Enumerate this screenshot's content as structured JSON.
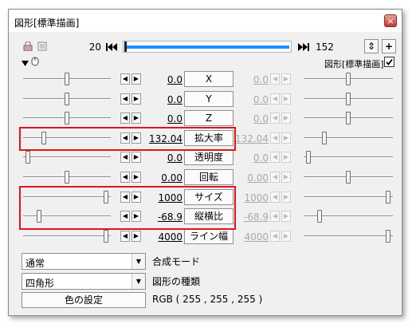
{
  "title": "図形[標準描画]",
  "close_glyph": "×",
  "timeline": {
    "start": "20",
    "end": "152"
  },
  "toolbar": {
    "refresh_glyph": "⇕",
    "add_glyph": "+"
  },
  "effect_header": {
    "label": "図形[標準描画]",
    "checked": true
  },
  "rows": [
    {
      "name": "x",
      "label": "X",
      "left_value": "0.0",
      "right_value": "0.0",
      "right_enabled": false,
      "left_level": 0.5,
      "right_level": 0.5
    },
    {
      "name": "y",
      "label": "Y",
      "left_value": "0.0",
      "right_value": "0.0",
      "right_enabled": false,
      "left_level": 0.5,
      "right_level": 0.5
    },
    {
      "name": "z",
      "label": "Z",
      "left_value": "0.0",
      "right_value": "0.0",
      "right_enabled": false,
      "left_level": 0.5,
      "right_level": 0.5
    },
    {
      "name": "scale",
      "label": "拡大率",
      "left_value": "132.04",
      "right_value": "132.04",
      "right_enabled": false,
      "left_level": 0.22,
      "right_level": 0.22
    },
    {
      "name": "opacity",
      "label": "透明度",
      "left_value": "0.0",
      "right_value": "0.0",
      "right_enabled": false,
      "left_level": 0.03,
      "right_level": 0.03
    },
    {
      "name": "rotation",
      "label": "回転",
      "left_value": "0.00",
      "right_value": "0.00",
      "right_enabled": false,
      "left_level": 0.5,
      "right_level": 0.5
    },
    {
      "name": "size",
      "label": "サイズ",
      "left_value": "1000",
      "right_value": "1000",
      "right_enabled": false,
      "left_level": 0.97,
      "right_level": 0.97
    },
    {
      "name": "aspect",
      "label": "縦横比",
      "left_value": "-68.9",
      "right_value": "-68.9",
      "right_enabled": false,
      "left_level": 0.16,
      "right_level": 0.16
    },
    {
      "name": "linewidth",
      "label": "ライン幅",
      "left_value": "4000",
      "right_value": "4000",
      "right_enabled": false,
      "left_level": 0.97,
      "right_level": 0.97
    }
  ],
  "blend": {
    "value": "通常",
    "label": "合成モード"
  },
  "shape": {
    "value": "四角形",
    "label": "図形の種類"
  },
  "color": {
    "button": "色の設定",
    "rgb": "RGB ( 255 , 255 , 255 )"
  },
  "colors": {
    "highlight": "#e0151b",
    "timeline_fill": "#1e90ff"
  }
}
